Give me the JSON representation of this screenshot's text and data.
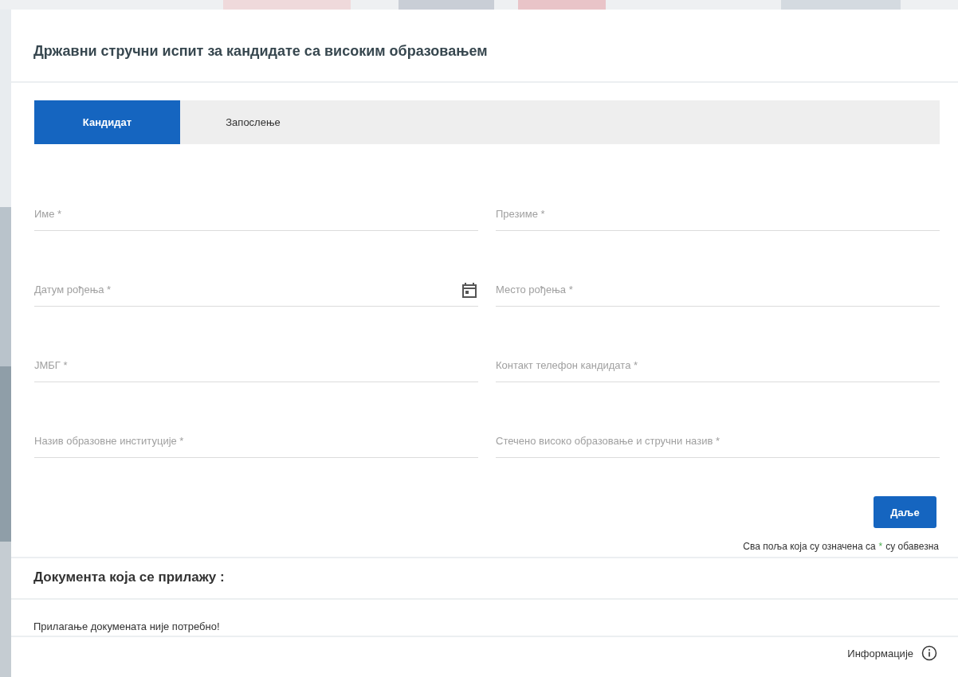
{
  "title": "Државни стручни испит за кандидате са високим образовањем",
  "tabs": [
    {
      "label": "Кандидат",
      "selected": true
    },
    {
      "label": "Запослење",
      "selected": false
    }
  ],
  "fields": [
    {
      "kind": "text",
      "placeholder": "Име *"
    },
    {
      "kind": "text",
      "placeholder": "Презиме *"
    },
    {
      "kind": "date",
      "placeholder": "Датум рођења *"
    },
    {
      "kind": "text",
      "placeholder": "Место рођења *"
    },
    {
      "kind": "text",
      "placeholder": "ЈМБГ *"
    },
    {
      "kind": "text",
      "placeholder": "Контакт телефон кандидата *"
    },
    {
      "kind": "text",
      "placeholder": "Назив образовне институције *"
    },
    {
      "kind": "text",
      "placeholder": "Стечено високо образовање и стручни назив *"
    }
  ],
  "next_button": "Даље",
  "required_note": {
    "before": "Сва поља која су означена са",
    "star": "*",
    "after": "су обавезна"
  },
  "documents": {
    "title": "Документа која се прилажу :",
    "text": "Прилагање докумената није потребно!"
  },
  "info_link": "Информације"
}
